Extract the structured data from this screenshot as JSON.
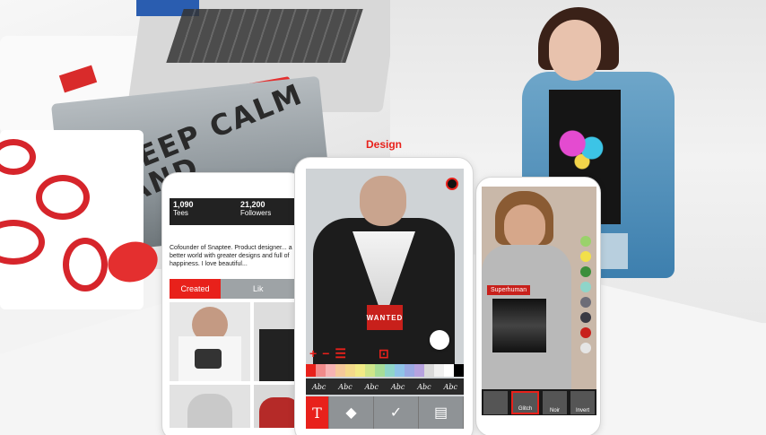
{
  "photo_left": {
    "shirt_text": "KEEP CALM AND"
  },
  "phone_left": {
    "stats": [
      {
        "value": "1,090",
        "label": "Tees"
      },
      {
        "value": "21,200",
        "label": "Followers"
      }
    ],
    "bio": "Cofounder of Snaptee. Product designer... a better world with greater designs and full of happiness. I love beautiful...",
    "tabs": {
      "active": "Created",
      "other": "Lik"
    }
  },
  "phone_center": {
    "header": "Design",
    "shirt_label": "WANTED",
    "tool_icons": [
      "+",
      "−",
      "☰",
      "⊡"
    ],
    "font_samples": [
      "Abc",
      "Abc",
      "Abc",
      "Abc",
      "Abc",
      "Abc"
    ],
    "toolbar": {
      "text_tool": "T",
      "fill_tool": "◆",
      "confirm": "✓",
      "layers": "▤"
    },
    "palette": [
      "#e8211b",
      "#f08a8a",
      "#f6b3b3",
      "#f5c89a",
      "#f4d98a",
      "#f2ea86",
      "#cfe58a",
      "#a6dc98",
      "#8fd5c9",
      "#8fc3e8",
      "#9aa9e3",
      "#b6a2df",
      "#d9d9d9",
      "#f0f0f0",
      "#ffffff",
      "#000000"
    ]
  },
  "phone_right": {
    "overlay_label": "Superhuman",
    "filters": [
      "",
      "Glitch",
      "Noir",
      "Invert"
    ],
    "color_dots": [
      "#9ad26b",
      "#f2e04a",
      "#3c8f3a",
      "#8fd5c9",
      "#6d6d78",
      "#3a3a44",
      "#c8201b",
      "#e5e5e5"
    ]
  },
  "colors": {
    "accent": "#e8211b"
  }
}
